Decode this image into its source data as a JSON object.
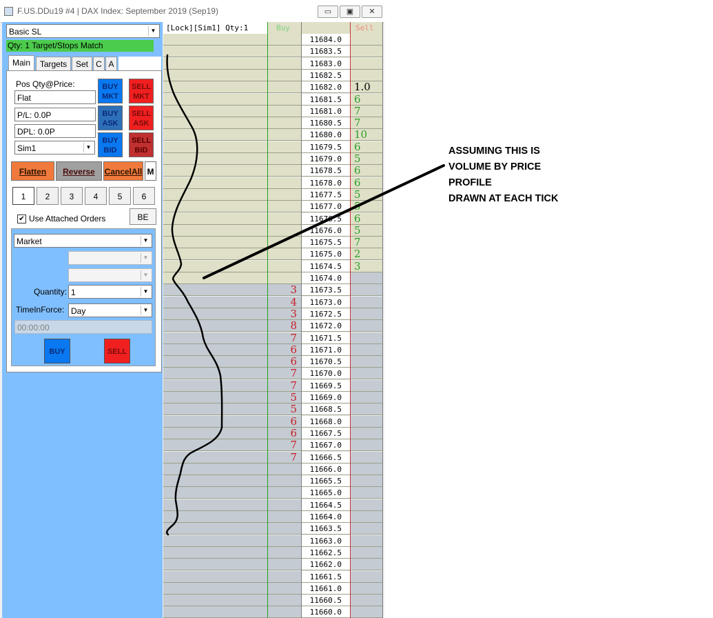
{
  "window": {
    "title": "F.US.DDu19  #4 | DAX Index: September 2019 (Sep19)",
    "minimize": "▭",
    "maximize": "▣",
    "close": "✕"
  },
  "panel": {
    "strategy_select": "Basic SL",
    "status_bar": "Qty: 1 Target/Stops Match",
    "tabs": [
      "Main",
      "Targets",
      "Set",
      "C",
      "A"
    ],
    "pos_label": "Pos Qty@Price:",
    "pos_value": "Flat",
    "pl_value": "P/L: 0.0P",
    "dpl_value": "DPL: 0.0P",
    "account_select": "Sim1",
    "buy_mkt": "BUY\nMKT",
    "sell_mkt": "SELL\nMKT",
    "buy_ask": "BUY\nASK",
    "sell_ask": "SELL\nASK",
    "buy_bid": "BUY\nBID",
    "sell_bid": "SELL\nBID",
    "flatten": "Flatten",
    "reverse": "Reverse",
    "cancel_all": "CancelAll",
    "m_button": "M",
    "numbers": [
      "1",
      "2",
      "3",
      "4",
      "5",
      "6"
    ],
    "use_attached": "Use Attached Orders",
    "be_button": "BE",
    "order_type": "Market",
    "quantity_label": "Quantity:",
    "quantity_value": "1",
    "tif_label": "TimeInForce:",
    "tif_value": "Day",
    "time_placeholder": "00:00:00",
    "buy": "BUY",
    "sell": "SELL"
  },
  "ladder": {
    "header_left": "[Lock][Sim1]  Qty:1",
    "header_buy": "Buy",
    "header_sell": "Sell",
    "current_price": "11674.0",
    "rows": [
      {
        "price": "11684.0",
        "buy": "",
        "sell": ""
      },
      {
        "price": "11683.5",
        "buy": "",
        "sell": ""
      },
      {
        "price": "11683.0",
        "buy": "",
        "sell": ""
      },
      {
        "price": "11682.5",
        "buy": "",
        "sell": ""
      },
      {
        "price": "11682.0",
        "buy": "",
        "sell": "1.0"
      },
      {
        "price": "11681.5",
        "buy": "",
        "sell": "6"
      },
      {
        "price": "11681.0",
        "buy": "",
        "sell": "7"
      },
      {
        "price": "11680.5",
        "buy": "",
        "sell": "7"
      },
      {
        "price": "11680.0",
        "buy": "",
        "sell": "10"
      },
      {
        "price": "11679.5",
        "buy": "",
        "sell": "6"
      },
      {
        "price": "11679.0",
        "buy": "",
        "sell": "5"
      },
      {
        "price": "11678.5",
        "buy": "",
        "sell": "6"
      },
      {
        "price": "11678.0",
        "buy": "",
        "sell": "6"
      },
      {
        "price": "11677.5",
        "buy": "",
        "sell": "5"
      },
      {
        "price": "11677.0",
        "buy": "",
        "sell": "5"
      },
      {
        "price": "11676.5",
        "buy": "",
        "sell": "6"
      },
      {
        "price": "11676.0",
        "buy": "",
        "sell": "5"
      },
      {
        "price": "11675.5",
        "buy": "",
        "sell": "7"
      },
      {
        "price": "11675.0",
        "buy": "",
        "sell": "2"
      },
      {
        "price": "11674.5",
        "buy": "",
        "sell": "3"
      },
      {
        "price": "11674.0",
        "buy": "",
        "sell": ""
      },
      {
        "price": "11673.5",
        "buy": "3",
        "sell": ""
      },
      {
        "price": "11673.0",
        "buy": "4",
        "sell": ""
      },
      {
        "price": "11672.5",
        "buy": "3",
        "sell": ""
      },
      {
        "price": "11672.0",
        "buy": "8",
        "sell": ""
      },
      {
        "price": "11671.5",
        "buy": "7",
        "sell": ""
      },
      {
        "price": "11671.0",
        "buy": "6",
        "sell": ""
      },
      {
        "price": "11670.5",
        "buy": "6",
        "sell": ""
      },
      {
        "price": "11670.0",
        "buy": "7",
        "sell": ""
      },
      {
        "price": "11669.5",
        "buy": "7",
        "sell": ""
      },
      {
        "price": "11669.0",
        "buy": "5",
        "sell": ""
      },
      {
        "price": "11668.5",
        "buy": "5",
        "sell": ""
      },
      {
        "price": "11668.0",
        "buy": "6",
        "sell": ""
      },
      {
        "price": "11667.5",
        "buy": "6",
        "sell": ""
      },
      {
        "price": "11667.0",
        "buy": "7",
        "sell": ""
      },
      {
        "price": "11666.5",
        "buy": "7",
        "sell": ""
      },
      {
        "price": "11666.0",
        "buy": "",
        "sell": ""
      },
      {
        "price": "11665.5",
        "buy": "",
        "sell": ""
      },
      {
        "price": "11665.0",
        "buy": "",
        "sell": ""
      },
      {
        "price": "11664.5",
        "buy": "",
        "sell": ""
      },
      {
        "price": "11664.0",
        "buy": "",
        "sell": ""
      },
      {
        "price": "11663.5",
        "buy": "",
        "sell": ""
      },
      {
        "price": "11663.0",
        "buy": "",
        "sell": ""
      },
      {
        "price": "11662.5",
        "buy": "",
        "sell": ""
      },
      {
        "price": "11662.0",
        "buy": "",
        "sell": ""
      },
      {
        "price": "11661.5",
        "buy": "",
        "sell": ""
      },
      {
        "price": "11661.0",
        "buy": "",
        "sell": ""
      },
      {
        "price": "11660.5",
        "buy": "",
        "sell": ""
      },
      {
        "price": "11660.0",
        "buy": "",
        "sell": ""
      }
    ]
  },
  "annotation": {
    "lines": [
      "ASSUMING THIS IS",
      "VOLUME BY PRICE",
      "PROFILE",
      "DRAWN AT EACH TICK"
    ]
  },
  "colors": {
    "panel_bg": "#80bfff",
    "status_green": "#4ccc4c",
    "ask_bg": "#e0e0c8",
    "bid_bg": "#c4cbd2",
    "buy_text": "#c81e28",
    "sell_text": "#28a028"
  }
}
